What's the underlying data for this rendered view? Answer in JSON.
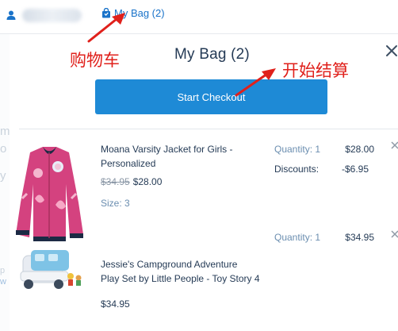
{
  "topbar": {
    "bag_link": "My Bag (2)"
  },
  "panel": {
    "title": "My Bag (2)",
    "checkout_label": "Start Checkout"
  },
  "annotations": {
    "cart": "购物车",
    "checkout": "开始结算"
  },
  "items": [
    {
      "name_line1": "Moana Varsity Jacket for Girls -",
      "name_line2": "Personalized",
      "original_price": "$34.95",
      "price": "$28.00",
      "size": "Size: 3",
      "quantity": "Quantity: 1",
      "line_total": "$28.00",
      "discount_label": "Discounts:",
      "discount_value": "-$6.95"
    },
    {
      "name_line1": "Jessie's Campground Adventure",
      "name_line2": "Play Set by Little People - Toy Story 4",
      "price": "$34.95",
      "quantity": "Quantity: 1",
      "line_total": "$34.95"
    }
  ],
  "colors": {
    "link_blue": "#1a73c9",
    "button_blue": "#1e8ad6",
    "annotation_red": "#e0201b",
    "text_dark": "#253b56",
    "text_muted": "#6b8eb0"
  },
  "icons": [
    "user-icon",
    "shopping-bag-icon",
    "close-icon",
    "remove-item-icon"
  ]
}
